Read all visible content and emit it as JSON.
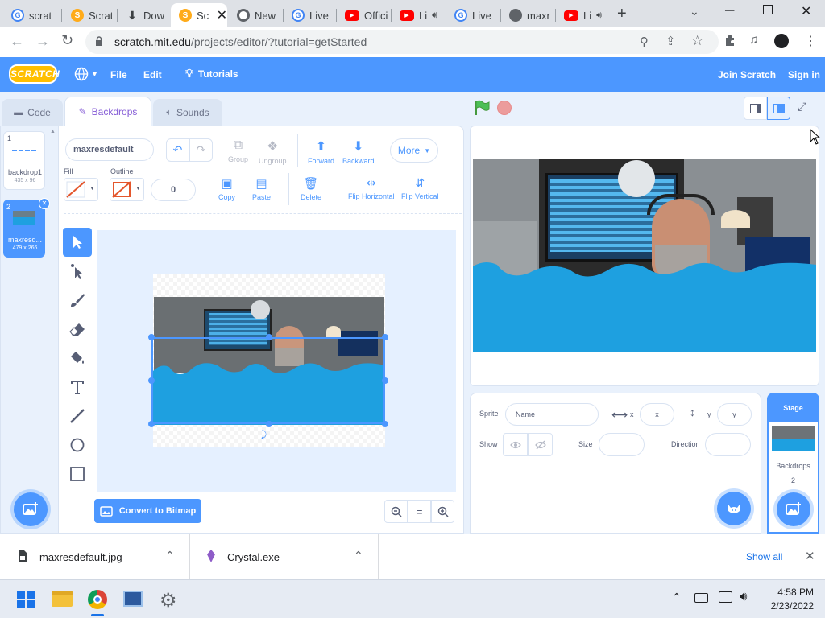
{
  "browser": {
    "tabs": [
      {
        "label": "scrat",
        "favicon": "google-icon",
        "color": "#4285f4"
      },
      {
        "label": "Scrat",
        "favicon": "scratch-icon",
        "color": "#ffab19"
      },
      {
        "label": "Dow",
        "favicon": "download-icon",
        "color": "#3c4043"
      },
      {
        "label": "Sc",
        "favicon": "scratch-icon",
        "color": "#ffab19",
        "active": true
      },
      {
        "label": "New",
        "favicon": "chrome-icon",
        "color": "#3c4043"
      },
      {
        "label": "Live",
        "favicon": "google-icon",
        "color": "#4285f4"
      },
      {
        "label": "Offici",
        "favicon": "youtube-icon",
        "color": "#ff0000"
      },
      {
        "label": "Li",
        "favicon": "youtube-icon",
        "color": "#ff0000"
      },
      {
        "label": "Live",
        "favicon": "google-icon",
        "color": "#4285f4"
      },
      {
        "label": "maxr",
        "favicon": "globe-icon",
        "color": "#5f6368"
      },
      {
        "label": "Li",
        "favicon": "youtube-icon",
        "color": "#ff0000"
      }
    ],
    "url_host": "scratch.mit.edu",
    "url_path": "/projects/editor/?tutorial=getStarted"
  },
  "menubar": {
    "logo": "SCRATCH",
    "file": "File",
    "edit": "Edit",
    "tutorials": "Tutorials",
    "join": "Join Scratch",
    "signin": "Sign in"
  },
  "editor_tabs": {
    "code": "Code",
    "backdrops": "Backdrops",
    "sounds": "Sounds"
  },
  "backdrops": [
    {
      "num": "1",
      "name": "backdrop1",
      "size": "435 x 96"
    },
    {
      "num": "2",
      "name": "maxresd...",
      "size": "479 x 266",
      "selected": true
    }
  ],
  "paint": {
    "costume_name": "maxresdefault",
    "group": "Group",
    "ungroup": "Ungroup",
    "forward": "Forward",
    "backward": "Backward",
    "more": "More",
    "fill_label": "Fill",
    "outline_label": "Outline",
    "outline_width": "0",
    "copy": "Copy",
    "paste": "Paste",
    "delete": "Delete",
    "flip_h": "Flip Horizontal",
    "flip_v": "Flip Vertical",
    "convert": "Convert to Bitmap",
    "zoom_reset": "="
  },
  "sprite_info": {
    "sprite_label": "Sprite",
    "name_placeholder": "Name",
    "x_label": "x",
    "x_placeholder": "x",
    "y_label": "y",
    "y_placeholder": "y",
    "show_label": "Show",
    "size_label": "Size",
    "direction_label": "Direction"
  },
  "stage_panel": {
    "title": "Stage",
    "backdrops_label": "Backdrops",
    "backdrops_count": "2"
  },
  "downloads": [
    {
      "name": "maxresdefault.jpg"
    },
    {
      "name": "Crystal.exe"
    }
  ],
  "downloads_show_all": "Show all",
  "taskbar": {
    "time": "4:58 PM",
    "date": "2/23/2022"
  },
  "colors": {
    "scratch_blue": "#4c97ff",
    "water": "#1ea0e0",
    "menu_blue": "#4c97ff"
  }
}
